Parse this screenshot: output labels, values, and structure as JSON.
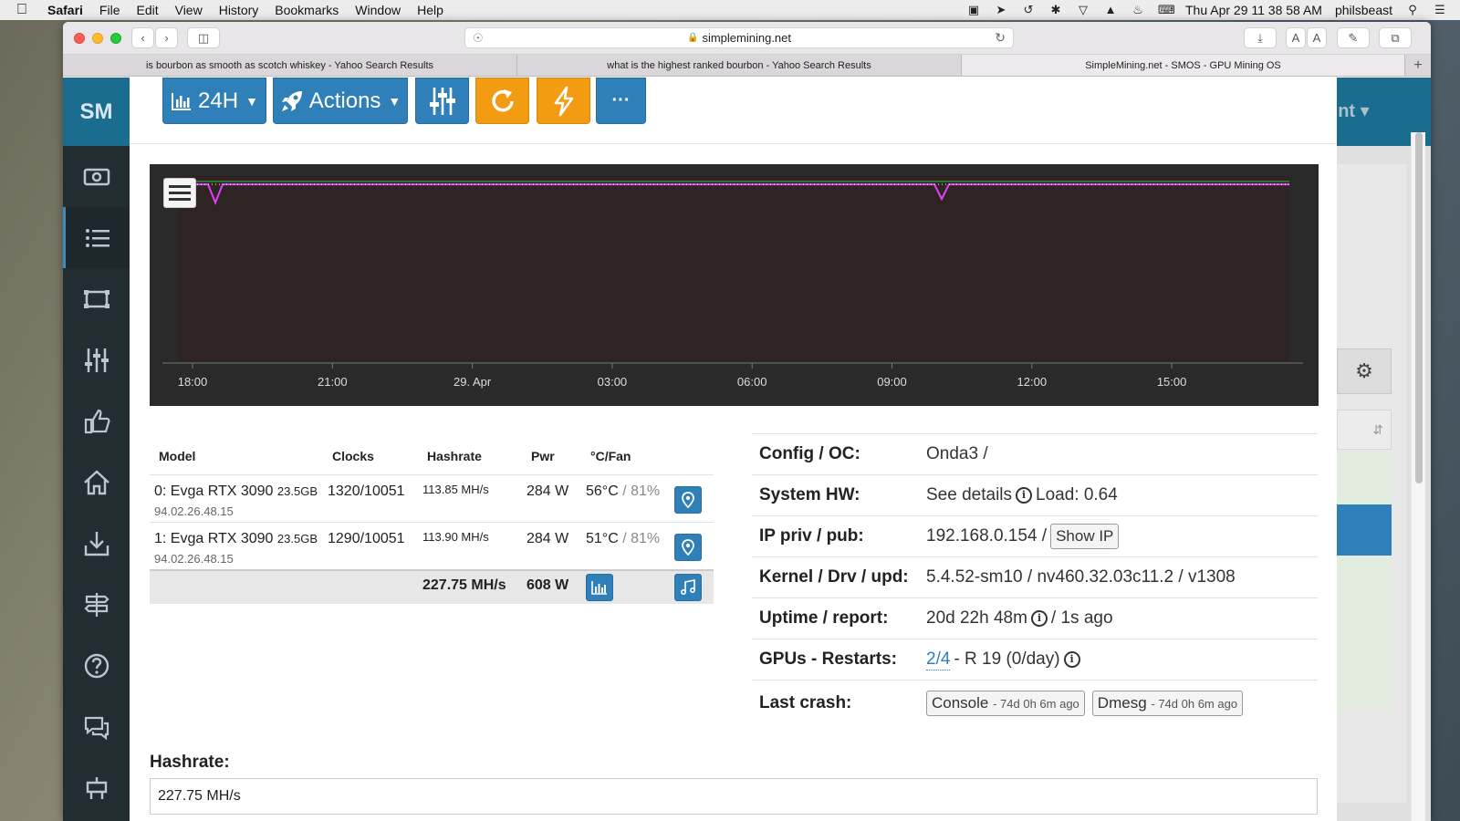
{
  "menubar": {
    "app": "Safari",
    "items": [
      "File",
      "Edit",
      "View",
      "History",
      "Bookmarks",
      "Window",
      "Help"
    ],
    "clock": "Thu Apr 29  11 38 58 AM",
    "user": "philsbeast"
  },
  "browser": {
    "url": "simplemining.net",
    "tabs": [
      "is bourbon as smooth as scotch whiskey - Yahoo Search Results",
      "what is the highest ranked bourbon - Yahoo Search Results",
      "SimpleMining.net - SMOS - GPU Mining OS"
    ]
  },
  "sidebar": {
    "logo": "SM",
    "icons": [
      "money-icon",
      "list-icon",
      "rigs-icon",
      "sliders-icon",
      "thumbs-up-icon",
      "home-icon",
      "download-icon",
      "signpost-icon",
      "help-icon",
      "chat-icon",
      "bottom-icon"
    ]
  },
  "toolbar": {
    "range_label": "24H",
    "actions_label": "Actions",
    "more_label": "···"
  },
  "right_header": {
    "text": "unt"
  },
  "chart_data": {
    "type": "line",
    "x_ticks": [
      "18:00",
      "21:00",
      "29. Apr",
      "03:00",
      "06:00",
      "09:00",
      "12:00",
      "15:00"
    ],
    "series": [
      {
        "color": "#e040fb",
        "values": [
          227.75,
          227.75,
          227.75,
          227.75,
          227.75,
          227.75,
          227.75,
          227.75
        ]
      },
      {
        "color": "#2e8b2e",
        "values": [
          228,
          228,
          228,
          228,
          228,
          228,
          228,
          228
        ]
      }
    ],
    "background": "#2f2424",
    "grid": false
  },
  "gpu_table": {
    "headers": {
      "model": "Model",
      "clocks": "Clocks",
      "hashrate": "Hashrate",
      "pwr": "Pwr",
      "temp_fan": "°C/Fan"
    },
    "rows": [
      {
        "model": "0: Evga RTX 3090",
        "mem": "23.5GB",
        "bios": "94.02.26.48.15",
        "clocks": "1320/10051",
        "hashrate": "113.85 MH/s",
        "pwr": "284 W",
        "temp": "56°C",
        "fan": "/ 81%"
      },
      {
        "model": "1: Evga RTX 3090",
        "mem": "23.5GB",
        "bios": "94.02.26.48.15",
        "clocks": "1290/10051",
        "hashrate": "113.90 MH/s",
        "pwr": "284 W",
        "temp": "51°C",
        "fan": "/ 81%"
      }
    ],
    "total_hashrate": "227.75 MH/s",
    "total_pwr": "608 W"
  },
  "info": {
    "config_label": "Config / OC:",
    "config_value": "Onda3 /",
    "hw_label": "System HW:",
    "hw_value": "See details",
    "hw_load": "Load: 0.64",
    "ip_label": "IP priv / pub:",
    "ip_value": "192.168.0.154 /",
    "ip_button": "Show IP",
    "kernel_label": "Kernel / Drv / upd:",
    "kernel_value": "5.4.52-sm10 / nv460.32.03c11.2 / v1308",
    "uptime_label": "Uptime / report:",
    "uptime_value": "20d 22h 48m",
    "report_value": "/ 1s ago",
    "gpus_label": "GPUs - Restarts:",
    "gpus_link": "2/4",
    "gpus_value": "- R 19 (0/day)",
    "crash_label": "Last crash:",
    "console_btn": "Console",
    "console_sub": "- 74d 0h 6m ago",
    "dmesg_btn": "Dmesg",
    "dmesg_sub": "- 74d 0h 6m ago"
  },
  "hashrate": {
    "label": "Hashrate:",
    "value": "227.75 MH/s"
  },
  "colors": {
    "accent_blue": "#2f7fb8",
    "accent_orange": "#f39c12",
    "sidebar": "#222d32",
    "logo_bg": "#1b6d8f"
  }
}
